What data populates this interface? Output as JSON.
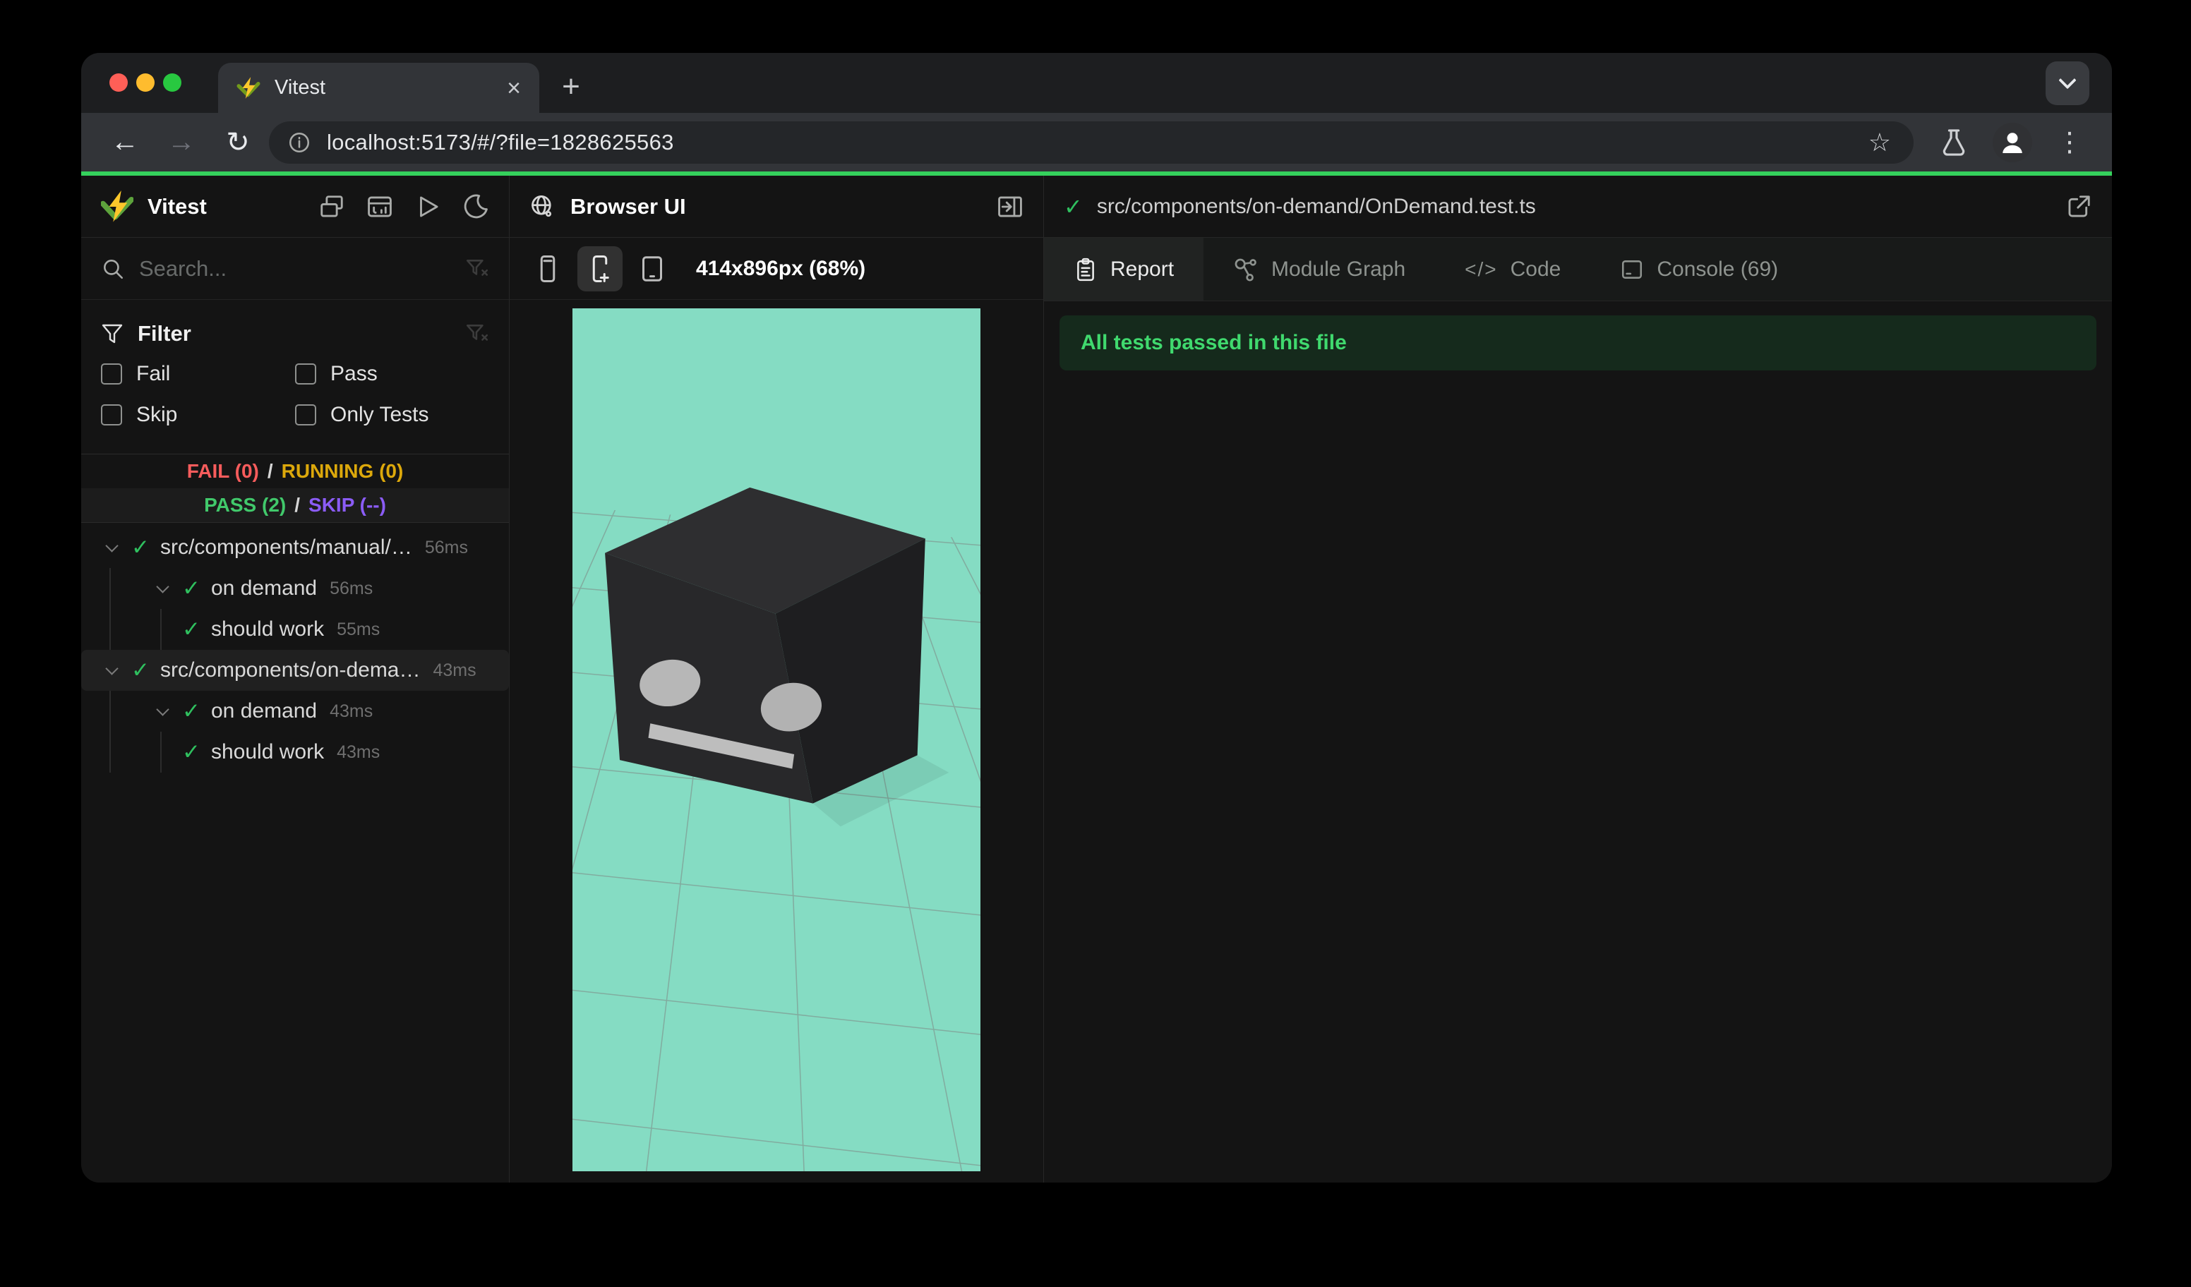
{
  "colors": {
    "accent_green": "#35d15c",
    "fail_red": "#f75c5c",
    "running_yellow": "#dca80b",
    "pass_green": "#41c96b",
    "skip_purple": "#8b5cf6",
    "check_green": "#2fc05f",
    "banner_bg": "#152a1c",
    "banner_text": "#40d96e",
    "preview_bg": "#85dcc3",
    "chrome_toolbar": "#323438",
    "panel_bg": "#141414"
  },
  "browser": {
    "tab_title": "Vitest",
    "close_tab": "×",
    "new_tab": "+",
    "back": "←",
    "forward": "→",
    "reload": "↻",
    "url": "localhost:5173/#/?file=1828625563",
    "star": "☆",
    "menu": "⋮"
  },
  "sidebar": {
    "app_name": "Vitest",
    "search_placeholder": "Search...",
    "filter": {
      "title": "Filter",
      "options": [
        "Fail",
        "Pass",
        "Skip",
        "Only Tests"
      ]
    },
    "summary": {
      "fail": "FAIL (0)",
      "running": "RUNNING (0)",
      "pass": "PASS (2)",
      "skip": "SKIP (--)",
      "sep": "/"
    },
    "tree": [
      {
        "type": "file",
        "depth": 0,
        "label": "src/components/manual/…",
        "time": "56ms",
        "selected": false
      },
      {
        "type": "suite",
        "depth": 1,
        "label": "on demand",
        "time": "56ms",
        "selected": false
      },
      {
        "type": "test",
        "depth": 2,
        "label": "should work",
        "time": "55ms",
        "selected": false
      },
      {
        "type": "file",
        "depth": 0,
        "label": "src/components/on-dema…",
        "time": "43ms",
        "selected": true
      },
      {
        "type": "suite",
        "depth": 1,
        "label": "on demand",
        "time": "43ms",
        "selected": false
      },
      {
        "type": "test",
        "depth": 2,
        "label": "should work",
        "time": "43ms",
        "selected": false
      }
    ],
    "check_glyph": "✓"
  },
  "preview": {
    "title": "Browser UI",
    "viewport_label": "414x896px (68%)"
  },
  "results": {
    "file_path": "src/components/on-demand/OnDemand.test.ts",
    "tabs": [
      {
        "label": "Report",
        "active": true
      },
      {
        "label": "Module Graph",
        "active": false
      },
      {
        "label": "Code",
        "active": false,
        "icon_glyph": "</>"
      },
      {
        "label": "Console (69)",
        "active": false
      }
    ],
    "banner": "All tests passed in this file"
  }
}
